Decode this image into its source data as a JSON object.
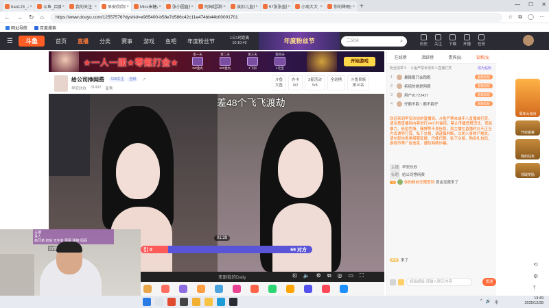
{
  "browser": {
    "tabs": [
      {
        "label": "hao123_上网从这里开始",
        "active": false
      },
      {
        "label": "斗鱼_百度搜索",
        "active": false
      },
      {
        "label": "我的关注 - 斗鱼",
        "active": false
      },
      {
        "label": "早安欣欣欣的直播间",
        "active": true
      },
      {
        "label": "Miss米糖儿的直播间",
        "active": false
      },
      {
        "label": "张小圆直播间",
        "active": false
      },
      {
        "label": "阿姆超甜辣的直播间",
        "active": false
      },
      {
        "label": "诶扣儿直播间",
        "active": false
      },
      {
        "label": "57张张直播间",
        "active": false
      },
      {
        "label": "小周大大 - 斗鱼",
        "active": false
      },
      {
        "label": "你的降雨无限签到",
        "active": false
      }
    ],
    "new_tab": "+",
    "window_controls": {
      "min": "—",
      "max": "☐",
      "close": "✕"
    },
    "url": "https://www.douyu.com/12557576?dyshid=e985400-b58e7d586c42c11e474bb44b00001701",
    "bookmarks": [
      "网址导航",
      "百度搜索"
    ]
  },
  "site": {
    "logo": "斗鱼",
    "nav": [
      {
        "label": "首页",
        "active": false
      },
      {
        "label": "直播",
        "active": true
      },
      {
        "label": "分类",
        "active": false
      },
      {
        "label": "赛事",
        "active": false
      },
      {
        "label": "游戏",
        "active": false
      },
      {
        "label": "鱼吧",
        "active": false
      },
      {
        "label": "年度粉丝节",
        "active": false
      }
    ],
    "time_box": [
      "1日1时距离",
      "10:10:42"
    ],
    "fest_banner": "年度粉丝节",
    "search_placeholder": "二朵朵",
    "header_icons": [
      "历史",
      "关注",
      "下载",
      "开播",
      "任务"
    ]
  },
  "ad": {
    "title": "★一人一服★零氪打金★",
    "items": [
      {
        "top": "第一天",
        "bottom": "2W金丸"
      },
      {
        "top": "第二天",
        "bottom": "500金丸"
      },
      {
        "top": "第三天",
        "bottom": "1飞剑"
      },
      {
        "top": "第四天",
        "bottom": "1元宝"
      }
    ],
    "start_button": "开始游戏"
  },
  "room": {
    "title": "给公司挣网费",
    "badges": [
      "528关注",
      "音频"
    ],
    "meta": [
      "早安欣欣",
      "31432",
      "星秀"
    ],
    "stats": [
      {
        "top": "斗鱼",
        "bottom": "大鱼"
      },
      {
        "top": "办卡",
        "bottom": "0/2"
      },
      {
        "top": "3星活动",
        "bottom": "5/8"
      },
      {
        "top": "全站榜",
        "bottom": ""
      },
      {
        "top": "斗鱼贵族",
        "bottom": "排10名"
      }
    ]
  },
  "video": {
    "caption": "差48个飞飞渡劫",
    "timer": "01:39",
    "pk": {
      "left_label": "引 0",
      "right_label": "69 对方",
      "left_score": 0,
      "right_score": 69
    },
    "watermark": "来跟我的Daily"
  },
  "webcam": {
    "board_lines": [
      "主播",
      "贵人",
      "高兄弟 叔伯 无牛有 刚豪 飘柳 妈妈"
    ],
    "subtitle": "57张张生日快乐"
  },
  "chat": {
    "tabs": [
      {
        "label": "在线榜",
        "active": false
      },
      {
        "label": "活跃榜",
        "active": false
      },
      {
        "label": "贵宾(6)",
        "active": false
      },
      {
        "label": "钻粉(6)",
        "active": true
      }
    ],
    "sub_left": "粉丝勋章 5",
    "sub_mid": "斗鱼严禁未成年人直播打赏",
    "sub_right": "成为钻粉",
    "rank": [
      {
        "n": "1",
        "name": "暴躁服只会跑跑",
        "badge": "超级欣欣"
      },
      {
        "n": "2",
        "name": "拆组的她是网瘾",
        "badge": "超级欣欣"
      },
      {
        "n": "3",
        "name": "用户81723427",
        "badge": "超级欣欣"
      },
      {
        "n": "4",
        "name": "仔颠不羁丶颠不羁仔",
        "badge": "超级欣欣"
      }
    ],
    "notice": "欢迎来到早安欣欣的直播间。斗鱼严禁未成年人直播或打赏，请注意直播间内容进行24小时监控，禁止传播违规违法、低俗暴力、低俗色情、赌博等不良信息，如主播在直播时以不正当方式诱导打赏、私下交易，请谨慎判断，以防人身财产损失。请勿轻信各类招聘征婚、代练代聊、私下交易、购买礼包码、游戏币等广告信息，谨防网络诈骗。",
    "host_rows": [
      {
        "tag": "主播",
        "value": "早安欣欣"
      },
      {
        "tag": "标题",
        "value": "给公司挣网费"
      }
    ],
    "msg1": {
      "level": "12",
      "text": "你的粉丝无限签到",
      "hl": "黄金宝藏来了"
    },
    "follow": {
      "level": "关爱",
      "text": "来了"
    },
    "input_placeholder": "超级超级 请输入聊天内容",
    "send": "发送"
  },
  "rail": [
    "周年大派对",
    "开启盛宴",
    "我的任务",
    "领取奖励"
  ],
  "taskbar": {
    "time": "13:49",
    "date": "2025/12/28",
    "sys": [
      "^",
      "🔊",
      "中"
    ]
  },
  "colors": {
    "accent": "#ff5d23",
    "header_bg": "#2b2b33",
    "pk_left": "#ff5a5a",
    "pk_right": "#5a54d8"
  }
}
